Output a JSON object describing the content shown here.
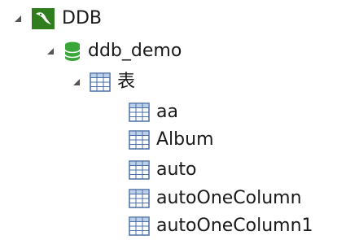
{
  "tree": {
    "root": {
      "label": "DDB",
      "icon": "mysql-dolphin-icon",
      "expanded": true
    },
    "database": {
      "label": "ddb_demo",
      "icon": "database-icon",
      "expanded": true
    },
    "tables_folder": {
      "label": "表",
      "icon": "table-icon",
      "expanded": true
    },
    "tables": [
      {
        "label": "aa",
        "icon": "table-icon"
      },
      {
        "label": "Album",
        "icon": "table-icon"
      },
      {
        "label": "auto",
        "icon": "table-icon"
      },
      {
        "label": "autoOneColumn",
        "icon": "table-icon"
      },
      {
        "label": "autoOneColumn1",
        "icon": "table-icon"
      }
    ]
  },
  "colors": {
    "expander": "#555555",
    "mysql_icon_bg": "#2f7d1f",
    "database_icon": "#3aa63a",
    "table_icon_border": "#4a6fa5",
    "table_icon_header": "#bcd0ea"
  }
}
